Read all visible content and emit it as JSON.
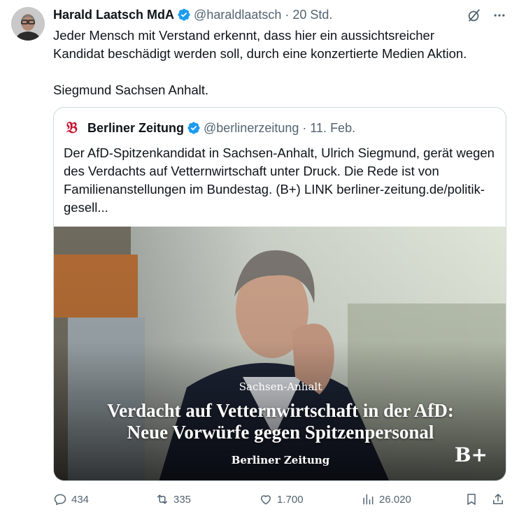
{
  "post": {
    "author_name": "Harald Laatsch MdA",
    "handle": "@haraldlaatsch",
    "separator": "·",
    "time": "20 Std.",
    "text": "Jeder Mensch mit Verstand erkennt, dass hier ein aussichtsreicher\nKandidat beschädigt werden soll, durch eine konzertierte Medien Aktion.\n\nSiegmund Sachsen Anhalt."
  },
  "quote": {
    "logo_glyph": "𝔅",
    "author_name": "Berliner Zeitung",
    "handle": "@berlinerzeitung",
    "separator": "·",
    "time": "11. Feb.",
    "text": "Der AfD-Spitzenkandidat in Sachsen-Anhalt, Ulrich Siegmund, gerät wegen des Verdachts auf Vetternwirtschaft unter Druck. Die Rede ist von Familienanstellungen im Bundestag.  (B+) LINK berliner-zeitung.de/politik-gesell...",
    "image": {
      "kicker": "Sachsen-Anhalt",
      "headline_line1": "Verdacht auf Vetternwirtschaft in der AfD:",
      "headline_line2": "Neue Vorwürfe gegen Spitzenpersonal",
      "brand": "Berliner Zeitung",
      "plus_badge": "B+"
    }
  },
  "actions": {
    "replies": "434",
    "reposts": "335",
    "likes": "1.700",
    "views": "26.020"
  },
  "colors": {
    "verified": "#1d9bf0",
    "secondary_text": "#536471",
    "border": "#cfd9de",
    "brand_red": "#c8102e"
  },
  "icons": {
    "grok": "grok-icon",
    "more": "more-icon",
    "reply": "reply-icon",
    "repost": "repost-icon",
    "like": "like-icon",
    "views": "views-icon",
    "bookmark": "bookmark-icon",
    "share": "share-icon"
  }
}
